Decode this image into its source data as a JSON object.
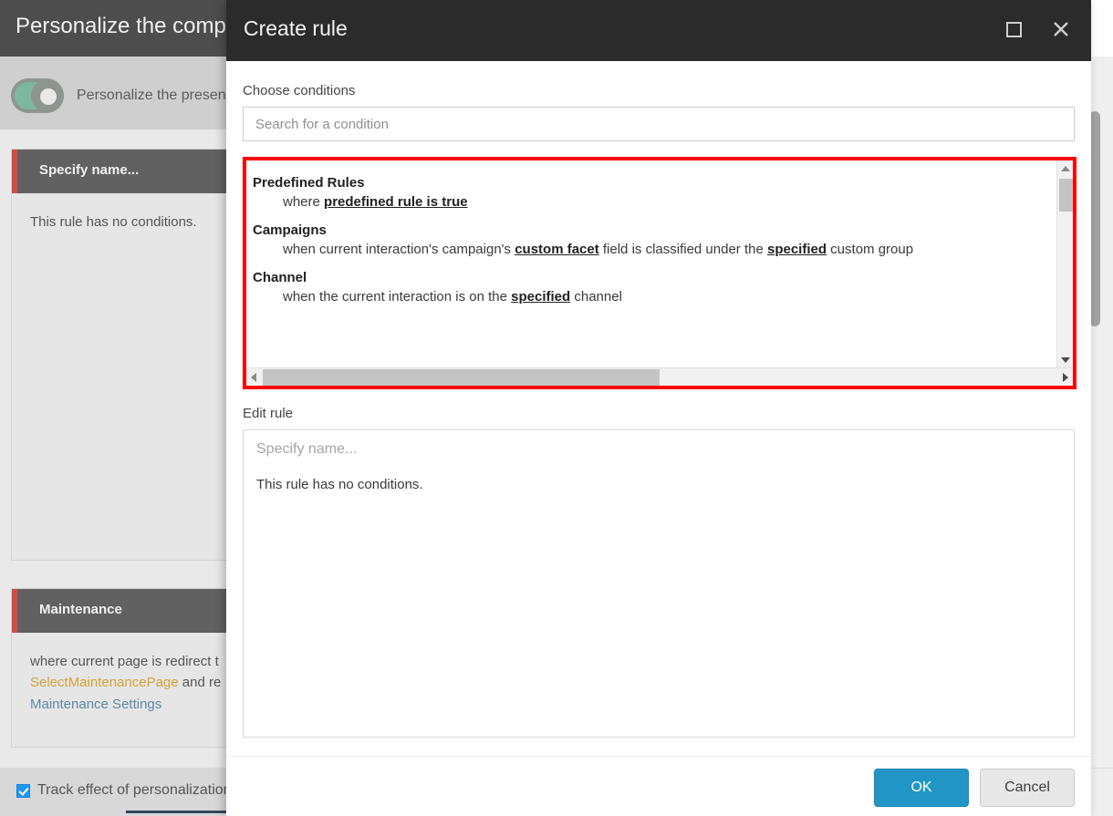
{
  "background": {
    "title": "Personalize the compo",
    "toggle": {
      "name": "personalize-presentation-toggle",
      "state": "on",
      "label": "Personalize the present",
      "color_on": "#7cb89f"
    },
    "cards": [
      {
        "title": "Specify name...",
        "accent": "#cf4d43",
        "body_plain": "This rule has no conditions."
      },
      {
        "title": "Maintenance",
        "accent": "#cf4d43",
        "body_segments": [
          {
            "text": "where current page is redirect t",
            "style": "plain"
          },
          {
            "text": "SelectMaintenancePage",
            "style": "yellow"
          },
          {
            "text": " and re",
            "style": "plain"
          },
          {
            "text": "Maintenance Settings",
            "style": "blue"
          }
        ]
      }
    ],
    "footer": {
      "checkbox_label": "Track effect of personalization",
      "checkbox_checked": true,
      "checkbox_color": "#2196f3"
    }
  },
  "dialog": {
    "title": "Create rule",
    "window_buttons": [
      {
        "name": "maximize-icon",
        "glyph": "square"
      },
      {
        "name": "close-icon",
        "glyph": "✕"
      }
    ],
    "choose_conditions_label": "Choose conditions",
    "search": {
      "placeholder": "Search for a condition",
      "value": ""
    },
    "conditions_groups": [
      {
        "group": "Predefined Rules",
        "items": [
          {
            "segments": [
              {
                "text": "where ",
                "link": false
              },
              {
                "text": "predefined rule is true",
                "link": true
              }
            ]
          }
        ]
      },
      {
        "group": "Campaigns",
        "items": [
          {
            "segments": [
              {
                "text": "when current interaction's campaign's ",
                "link": false
              },
              {
                "text": "custom facet",
                "link": true
              },
              {
                "text": " field is classified under the ",
                "link": false
              },
              {
                "text": "specified",
                "link": true
              },
              {
                "text": " custom group",
                "link": false
              }
            ]
          }
        ]
      },
      {
        "group": "Channel",
        "items": [
          {
            "segments": [
              {
                "text": "when the current interaction is on the ",
                "link": false
              },
              {
                "text": "specified",
                "link": true
              },
              {
                "text": " channel",
                "link": false
              }
            ]
          }
        ]
      }
    ],
    "highlight_color": "#ff0000",
    "edit_rule_label": "Edit rule",
    "edit_rule": {
      "name_placeholder": "Specify name...",
      "name_value": "",
      "empty_text": "This rule has no conditions."
    },
    "buttons": {
      "ok": "OK",
      "cancel": "Cancel",
      "ok_color": "#2196c4"
    }
  }
}
